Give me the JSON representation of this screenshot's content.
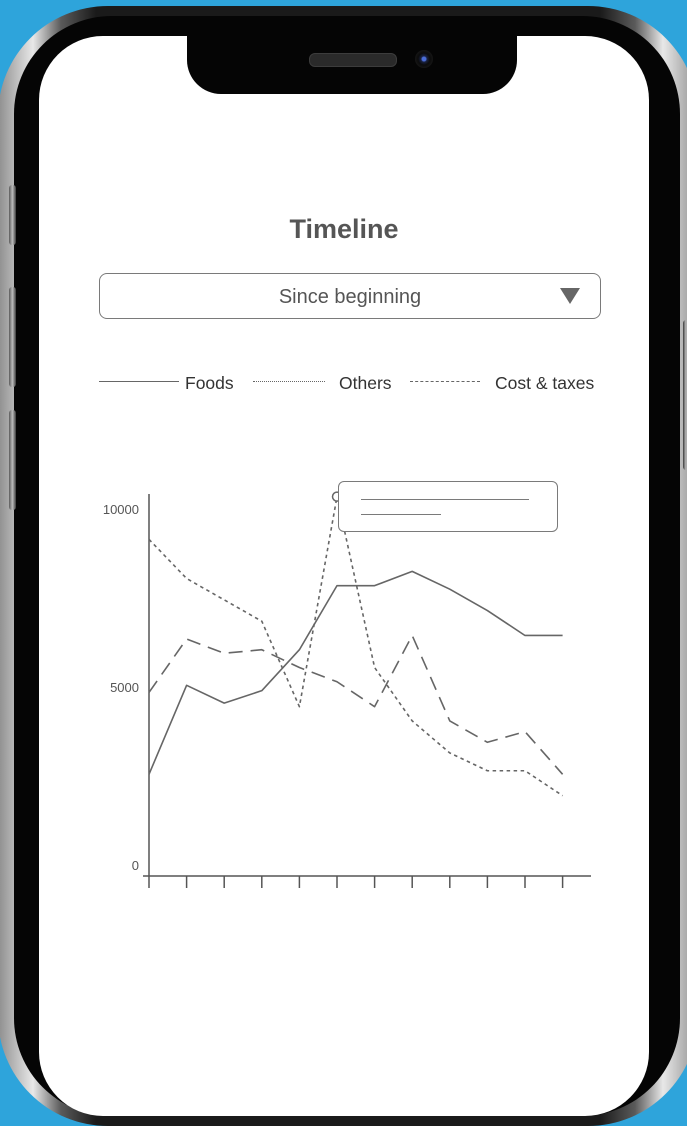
{
  "screen": {
    "title": "Timeline",
    "filter": {
      "selected": "Since beginning"
    },
    "legend": [
      {
        "name": "Foods",
        "style": "solid"
      },
      {
        "name": "Others",
        "style": "dotted"
      },
      {
        "name": "Cost & taxes",
        "style": "dashed"
      }
    ]
  },
  "chart_data": {
    "type": "line",
    "x": [
      0,
      1,
      2,
      3,
      4,
      5,
      6,
      7,
      8,
      9,
      10,
      11
    ],
    "ylim": [
      0,
      10000
    ],
    "ytick_labels": [
      "0",
      "5000",
      "10000"
    ],
    "yticks": [
      0,
      5000,
      10000
    ],
    "grid": false,
    "legend_position": "top",
    "series": [
      {
        "name": "Foods",
        "style": "solid",
        "values": [
          2800,
          5300,
          4800,
          5150,
          6300,
          8100,
          8100,
          8500,
          8000,
          7400,
          6700,
          6700
        ]
      },
      {
        "name": "Others",
        "style": "dotted",
        "values": [
          9400,
          8300,
          7700,
          7100,
          4700,
          10600,
          5800,
          4300,
          3400,
          2900,
          2900,
          2200
        ]
      },
      {
        "name": "Cost & taxes",
        "style": "dashed",
        "values": [
          5100,
          6600,
          6200,
          6300,
          5800,
          5400,
          4700,
          6700,
          4300,
          3700,
          4000,
          2800
        ]
      }
    ],
    "highlighted_point": {
      "series": "Others",
      "x": 5,
      "value": 10600
    },
    "colors": {
      "line": "#666666",
      "axis": "#555555"
    }
  }
}
